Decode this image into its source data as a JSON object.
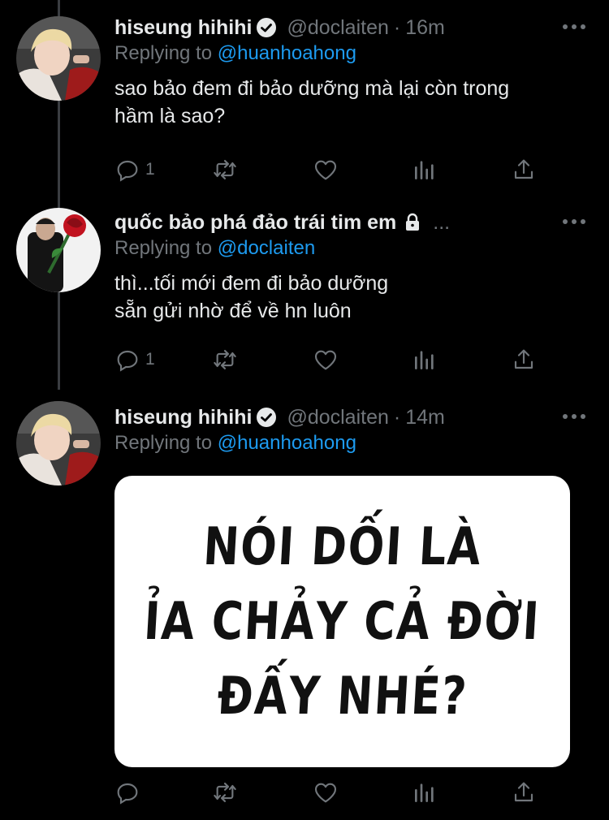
{
  "tweets": [
    {
      "name": "hiseung hihihi",
      "handle": "@doclaiten",
      "time": "16m",
      "replying_label": "Replying to",
      "replying_to": "@huanhoahong",
      "text_lines": [
        "sao bảo đem đi bảo dưỡng mà lại còn trong",
        "hầm là sao?"
      ],
      "reply_count": "1",
      "verified": true
    },
    {
      "name": "quốc bảo phá đảo trái tim em",
      "ellipsis": "...",
      "handle": "",
      "replying_label": "Replying to",
      "replying_to": "@doclaiten",
      "text_lines": [
        "thì...tối mới đem đi bảo dưỡng",
        "sẵn gửi nhờ để về hn luôn"
      ],
      "reply_count": "1",
      "locked": true
    },
    {
      "name": "hiseung hihihi",
      "handle": "@doclaiten",
      "time": "14m",
      "replying_label": "Replying to",
      "replying_to": "@huanhoahong",
      "media_text": [
        "NÓI DỐI LÀ",
        "ỈA CHẢY CẢ ĐỜI",
        "ĐẤY NHÉ?"
      ],
      "verified": true
    }
  ],
  "icons": {
    "reply": "reply-icon",
    "retweet": "retweet-icon",
    "like": "heart-icon",
    "analytics": "analytics-icon",
    "share": "share-icon",
    "more": "more-icon",
    "verified": "verified-badge-icon",
    "lock": "lock-icon"
  },
  "colors": {
    "background": "#000000",
    "text": "#e7e9ea",
    "secondary": "#71767b",
    "link": "#1d9bf0"
  }
}
